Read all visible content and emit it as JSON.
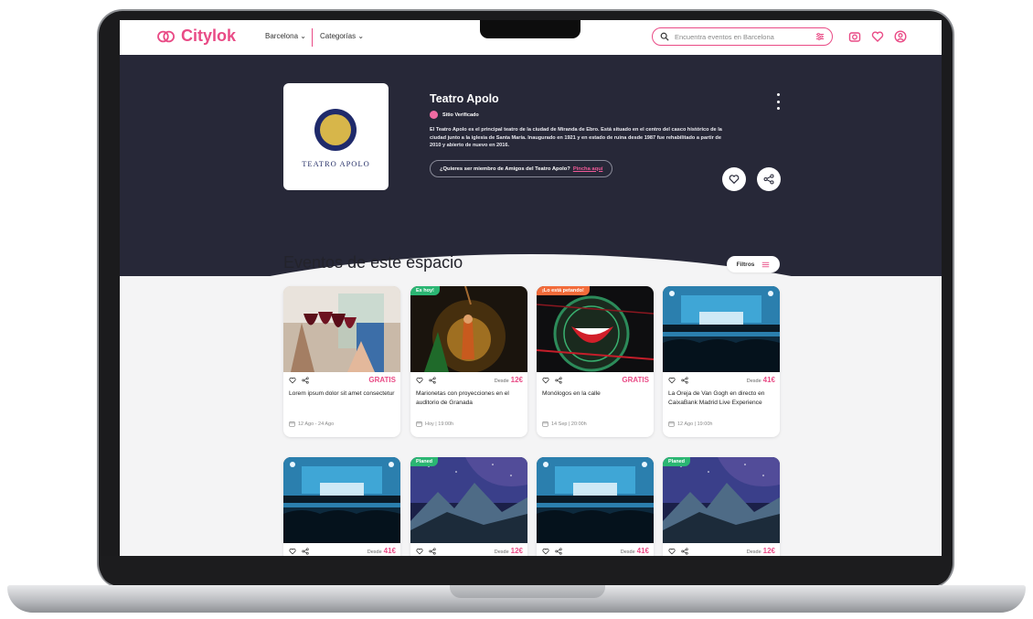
{
  "header": {
    "brand": "Citylok",
    "city": "Barcelona",
    "categories": "Categorías",
    "search_placeholder": "Encuentra eventos en Barcelona",
    "icons": [
      "camera-icon",
      "heart-icon",
      "user-icon"
    ]
  },
  "venue": {
    "logo_text": "TEATRO APOLO",
    "name": "Teatro Apolo",
    "verified_label": "Sitio Verificado",
    "description": "El Teatro Apolo es el principal teatro de la ciudad de Miranda de Ebro. Está situado en el centro del casco histórico de la ciudad junto a la iglesia de Santa María. Inaugurado en 1921 y en estado de ruina desde 1987 fue rehabilitado a partir de 2010 y abierto de nuevo en 2016.",
    "member_text": "¿Quieres ser miembro de Amigos del Teatro Apolo?",
    "member_link": "Pincha aquí"
  },
  "events_section": {
    "title": "Eventos de este espacio",
    "filters_label": "Filtros"
  },
  "cards": [
    {
      "badge": "",
      "price_prefix": "",
      "price": "GRATIS",
      "title": "Lorem ipsum dolor sit amet consectetur",
      "date": "12 Ago - 24 Ago",
      "image": "wine-toast"
    },
    {
      "badge": "Es hoy!",
      "price_prefix": "Desde",
      "price": "12€",
      "title": "Marionetas con proyecciones en el auditorio de Granada",
      "date": "Hoy | 19:00h",
      "image": "puppets"
    },
    {
      "badge": "¡Lo está petando!",
      "price_prefix": "",
      "price": "GRATIS",
      "title": "Monólogos en la calle",
      "date": "14 Sep | 20:00h",
      "image": "comedy-sign"
    },
    {
      "badge": "",
      "price_prefix": "Desde",
      "price": "41€",
      "title": "La Oreja de Van Gogh en directo en CaixaBank Madrid Live Experience",
      "date": "12 Ago | 19:00h",
      "image": "concert"
    },
    {
      "badge": "",
      "price_prefix": "Desde",
      "price": "41€",
      "title": "",
      "date": "",
      "image": "concert"
    },
    {
      "badge": "Planed",
      "price_prefix": "Desde",
      "price": "12€",
      "title": "",
      "date": "",
      "image": "mountains"
    },
    {
      "badge": "",
      "price_prefix": "Desde",
      "price": "41€",
      "title": "",
      "date": "",
      "image": "concert"
    },
    {
      "badge": "Planed",
      "price_prefix": "Desde",
      "price": "12€",
      "title": "",
      "date": "",
      "image": "mountains"
    }
  ],
  "colors": {
    "accent": "#e94b86",
    "hero_bg": "#272838",
    "badge_green": "#2bb673",
    "badge_orange": "#f26b3a"
  }
}
